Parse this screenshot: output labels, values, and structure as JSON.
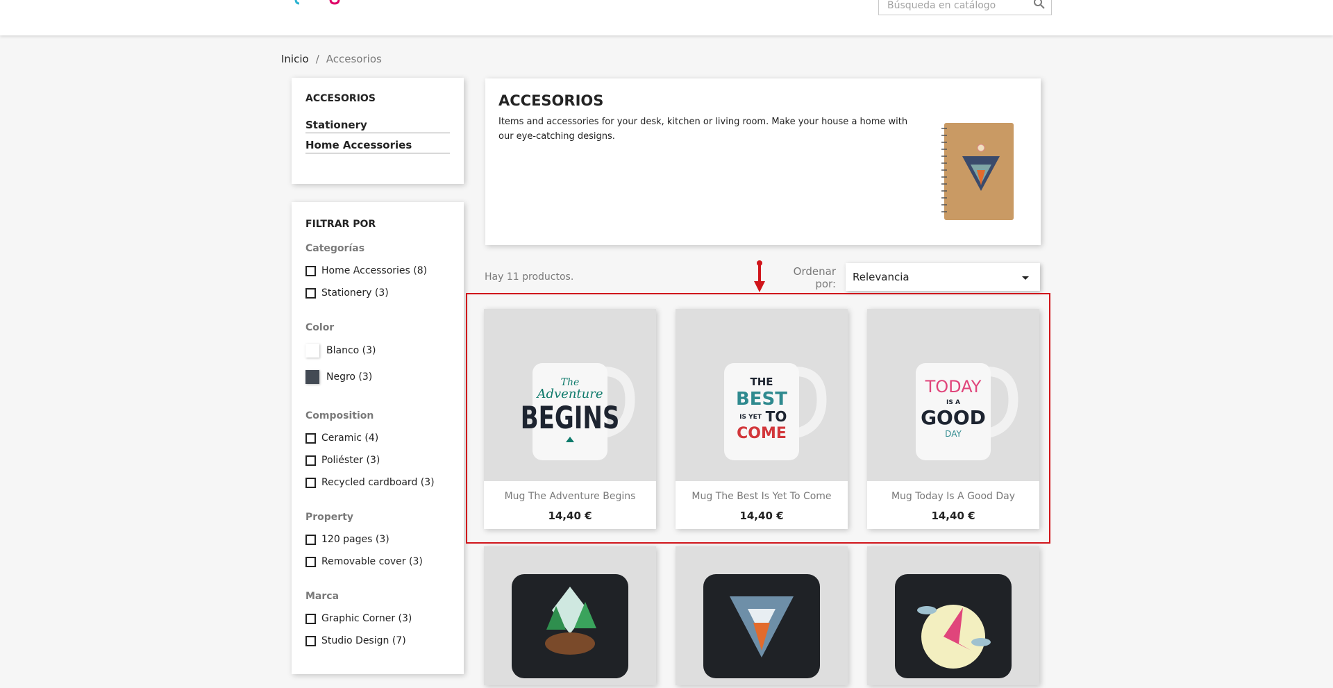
{
  "header": {
    "search_placeholder": "Búsqueda en catálogo"
  },
  "breadcrumb": {
    "home": "Inicio",
    "separator": "/",
    "current": "Accesorios"
  },
  "category_block": {
    "title": "ACCESORIOS",
    "links": [
      "Stationery",
      "Home Accessories"
    ]
  },
  "filters": {
    "title": "FILTRAR POR",
    "categories": {
      "title": "Categorías",
      "items": [
        "Home Accessories (8)",
        "Stationery (3)"
      ]
    },
    "color": {
      "title": "Color",
      "items": [
        {
          "label": "Blanco (3)",
          "color": "#ffffff"
        },
        {
          "label": "Negro (3)",
          "color": "#434a54"
        }
      ]
    },
    "composition": {
      "title": "Composition",
      "items": [
        "Ceramic (4)",
        "Poliéster (3)",
        "Recycled cardboard (3)"
      ]
    },
    "property": {
      "title": "Property",
      "items": [
        "120 pages (3)",
        "Removable cover (3)"
      ]
    },
    "brand": {
      "title": "Marca",
      "items": [
        "Graphic Corner (3)",
        "Studio Design (7)"
      ]
    }
  },
  "category_header": {
    "title": "ACCESORIOS",
    "description": "Items and accessories for your desk, kitchen or living room. Make your house a home with our eye-catching designs."
  },
  "listing": {
    "count_text": "Hay 11 productos.",
    "sort_label": "Ordenar por:",
    "sort_value": "Relevancia"
  },
  "products": [
    {
      "name": "Mug The Adventure Begins",
      "price": "14,40 €",
      "mug_lines": [
        "The",
        "Adventure",
        "BEGINS"
      ]
    },
    {
      "name": "Mug The Best Is Yet To Come",
      "price": "14,40 €",
      "mug_lines": [
        "THE",
        "BEST",
        "IS YET",
        "TO",
        "COME"
      ]
    },
    {
      "name": "Mug Today Is A Good Day",
      "price": "14,40 €",
      "mug_lines": [
        "TODAY",
        "IS A",
        "GOOD",
        "DAY"
      ]
    }
  ],
  "colors": {
    "highlight": "#d0151b",
    "accent": "#2fb5d2"
  }
}
